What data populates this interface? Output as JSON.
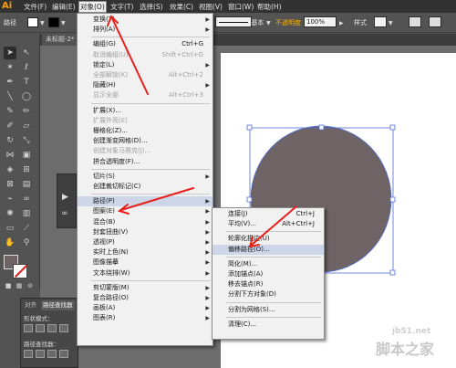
{
  "app": {
    "logo": "Ai"
  },
  "menubar": [
    "文件(F)",
    "编辑(E)",
    "对象(O)",
    "文字(T)",
    "选择(S)",
    "效果(C)",
    "视图(V)",
    "窗口(W)",
    "帮助(H)"
  ],
  "controlbar": {
    "mode": "路径",
    "stroke_style": "基本",
    "opacity_label": "不透明度",
    "opacity_value": "100%",
    "style_label": "样式",
    "fill_color": "#ffffff",
    "stroke_color": "#000000"
  },
  "document_tab": "未标题-2* @",
  "object_menu": [
    {
      "label": "变换(T)",
      "submenu": true
    },
    {
      "label": "排列(A)",
      "submenu": true
    },
    {
      "separator": true
    },
    {
      "label": "编组(G)",
      "shortcut": "Ctrl+G"
    },
    {
      "label": "取消编组(U)",
      "shortcut": "Shift+Ctrl+G",
      "disabled": true
    },
    {
      "label": "锁定(L)",
      "submenu": true
    },
    {
      "label": "全部解锁(K)",
      "shortcut": "Alt+Ctrl+2",
      "disabled": true
    },
    {
      "label": "隐藏(H)",
      "submenu": true
    },
    {
      "label": "显示全部",
      "shortcut": "Alt+Ctrl+3",
      "disabled": true
    },
    {
      "separator": true
    },
    {
      "label": "扩展(X)..."
    },
    {
      "label": "扩展外观(E)",
      "disabled": true
    },
    {
      "label": "栅格化(Z)..."
    },
    {
      "label": "创建渐变网格(D)..."
    },
    {
      "label": "创建对象马赛克(J)...",
      "disabled": true
    },
    {
      "label": "拼合透明度(F)..."
    },
    {
      "separator": true
    },
    {
      "label": "切片(S)",
      "submenu": true
    },
    {
      "label": "创建裁切标记(C)"
    },
    {
      "separator": true
    },
    {
      "label": "路径(P)",
      "submenu": true,
      "highlighted": true
    },
    {
      "label": "图案(E)",
      "submenu": true
    },
    {
      "label": "混合(B)",
      "submenu": true
    },
    {
      "label": "封套扭曲(V)",
      "submenu": true
    },
    {
      "label": "透视(P)",
      "submenu": true
    },
    {
      "label": "实时上色(N)",
      "submenu": true
    },
    {
      "label": "图像描摹",
      "submenu": true
    },
    {
      "label": "文本绕排(W)",
      "submenu": true
    },
    {
      "separator": true
    },
    {
      "label": "剪切蒙版(M)",
      "submenu": true
    },
    {
      "label": "复合路径(O)",
      "submenu": true
    },
    {
      "label": "画板(A)",
      "submenu": true
    },
    {
      "label": "图表(R)",
      "submenu": true
    }
  ],
  "path_submenu": [
    {
      "label": "连接(J)",
      "shortcut": "Ctrl+J"
    },
    {
      "label": "平均(V)...",
      "shortcut": "Alt+Ctrl+J"
    },
    {
      "separator": true
    },
    {
      "label": "轮廓化描边(U)"
    },
    {
      "label": "偏移路径(O)...",
      "highlighted": true
    },
    {
      "separator": true
    },
    {
      "label": "简化(M)..."
    },
    {
      "label": "添加锚点(A)"
    },
    {
      "label": "移去锚点(R)"
    },
    {
      "label": "分割下方对象(D)"
    },
    {
      "separator": true
    },
    {
      "label": "分割为网格(S)..."
    },
    {
      "separator": true
    },
    {
      "label": "清理(C)..."
    }
  ],
  "panels": {
    "tab_transparency": "对齐",
    "tab_pathfinder": "路径查找器",
    "shape_modes": "形状模式：",
    "pathfinder": "路径查找器："
  },
  "canvas": {
    "shape_fill": "#6e6465",
    "selection_color": "#4f6dd6"
  },
  "annotation_color": "#e8201c",
  "watermark": {
    "url": "jb51.net",
    "name": "脚本之家"
  }
}
